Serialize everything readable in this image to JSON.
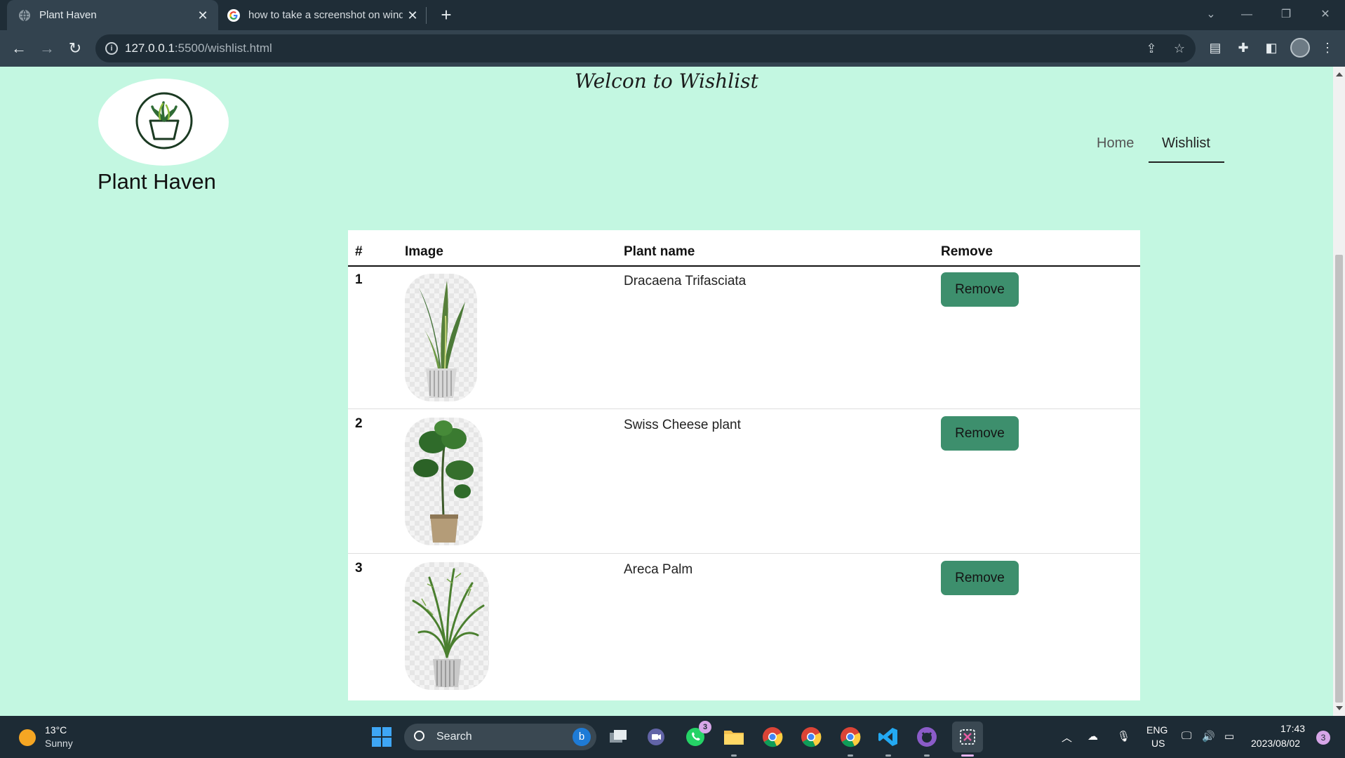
{
  "browser": {
    "tabs": [
      {
        "title": "Plant Haven",
        "active": true
      },
      {
        "title": "how to take a screenshot on windows",
        "active": false
      }
    ],
    "url_host": "127.0.0.1",
    "url_path": ":5500/wishlist.html"
  },
  "page": {
    "welcome": "Welcon to Wishlist",
    "brand": "Plant Haven",
    "nav": [
      {
        "label": "Home",
        "active": false
      },
      {
        "label": "Wishlist",
        "active": true
      }
    ],
    "table": {
      "headers": [
        "#",
        "Image",
        "Plant name",
        "Remove"
      ],
      "rows": [
        {
          "num": "1",
          "name": "Dracaena Trifasciata",
          "image": "snake-plant",
          "remove_label": "Remove"
        },
        {
          "num": "2",
          "name": "Swiss Cheese plant",
          "image": "monstera-plant",
          "remove_label": "Remove"
        },
        {
          "num": "3",
          "name": "Areca Palm",
          "image": "areca-palm-plant",
          "remove_label": "Remove"
        }
      ]
    }
  },
  "taskbar": {
    "weather_temp": "13°C",
    "weather_desc": "Sunny",
    "search_placeholder": "Search",
    "whatsapp_badge": "3",
    "lang_top": "ENG",
    "lang_bottom": "US",
    "time": "17:43",
    "date": "2023/08/02",
    "notifications": "3"
  },
  "colors": {
    "page_bg": "#c3f7e1",
    "button_bg": "#3d8f6d",
    "chrome_dark": "#1f2d37",
    "chrome_mid": "#33434f"
  }
}
